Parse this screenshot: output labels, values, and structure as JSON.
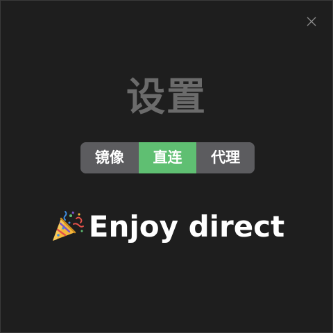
{
  "dialog": {
    "title": "设置",
    "close_icon": "close-icon",
    "modes": [
      {
        "label": "镜像",
        "active": false
      },
      {
        "label": "直连",
        "active": true
      },
      {
        "label": "代理",
        "active": false
      }
    ],
    "message": {
      "icon": "party-popper-icon",
      "text": "Enjoy direct"
    },
    "colors": {
      "background": "#1e1e1e",
      "title": "#6b6b6b",
      "segment": "#5c5c5f",
      "segment_active": "#5fbf72",
      "text": "#ffffff"
    }
  }
}
